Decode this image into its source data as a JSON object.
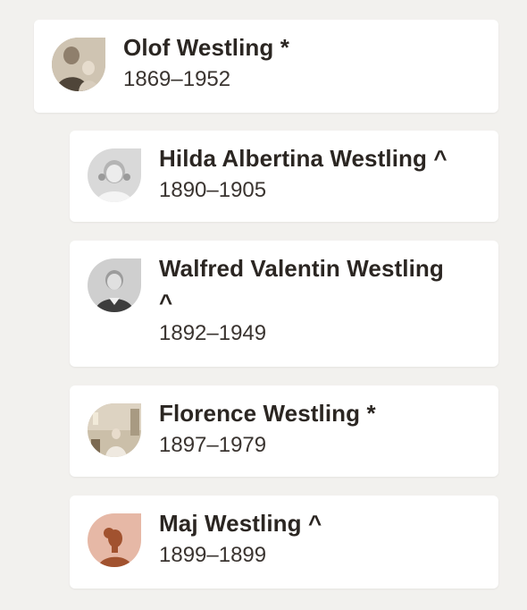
{
  "people": [
    {
      "name": "Olof Westling *",
      "years": "1869–1952",
      "avatar_icon": "photo-elderly-man-with-child"
    },
    {
      "name": "Hilda Albertina Westling ^",
      "years": "1890–1905",
      "avatar_icon": "photo-young-girl"
    },
    {
      "name_line1": "Walfred Valentin Westling",
      "name_line2": "^",
      "years": "1892–1949",
      "avatar_icon": "photo-young-boy"
    },
    {
      "name": "Florence Westling *",
      "years": "1897–1979",
      "avatar_icon": "photo-elderly-woman-in-room"
    },
    {
      "name": "Maj Westling ^",
      "years": "1899–1899",
      "avatar_icon": "silhouette-woman-placeholder"
    }
  ],
  "colors": {
    "background": "#f2f1ee",
    "card": "#ffffff",
    "text": "#2b2622",
    "placeholder_avatar_bg": "#e6b8a6",
    "placeholder_avatar_figure": "#a1522f"
  }
}
